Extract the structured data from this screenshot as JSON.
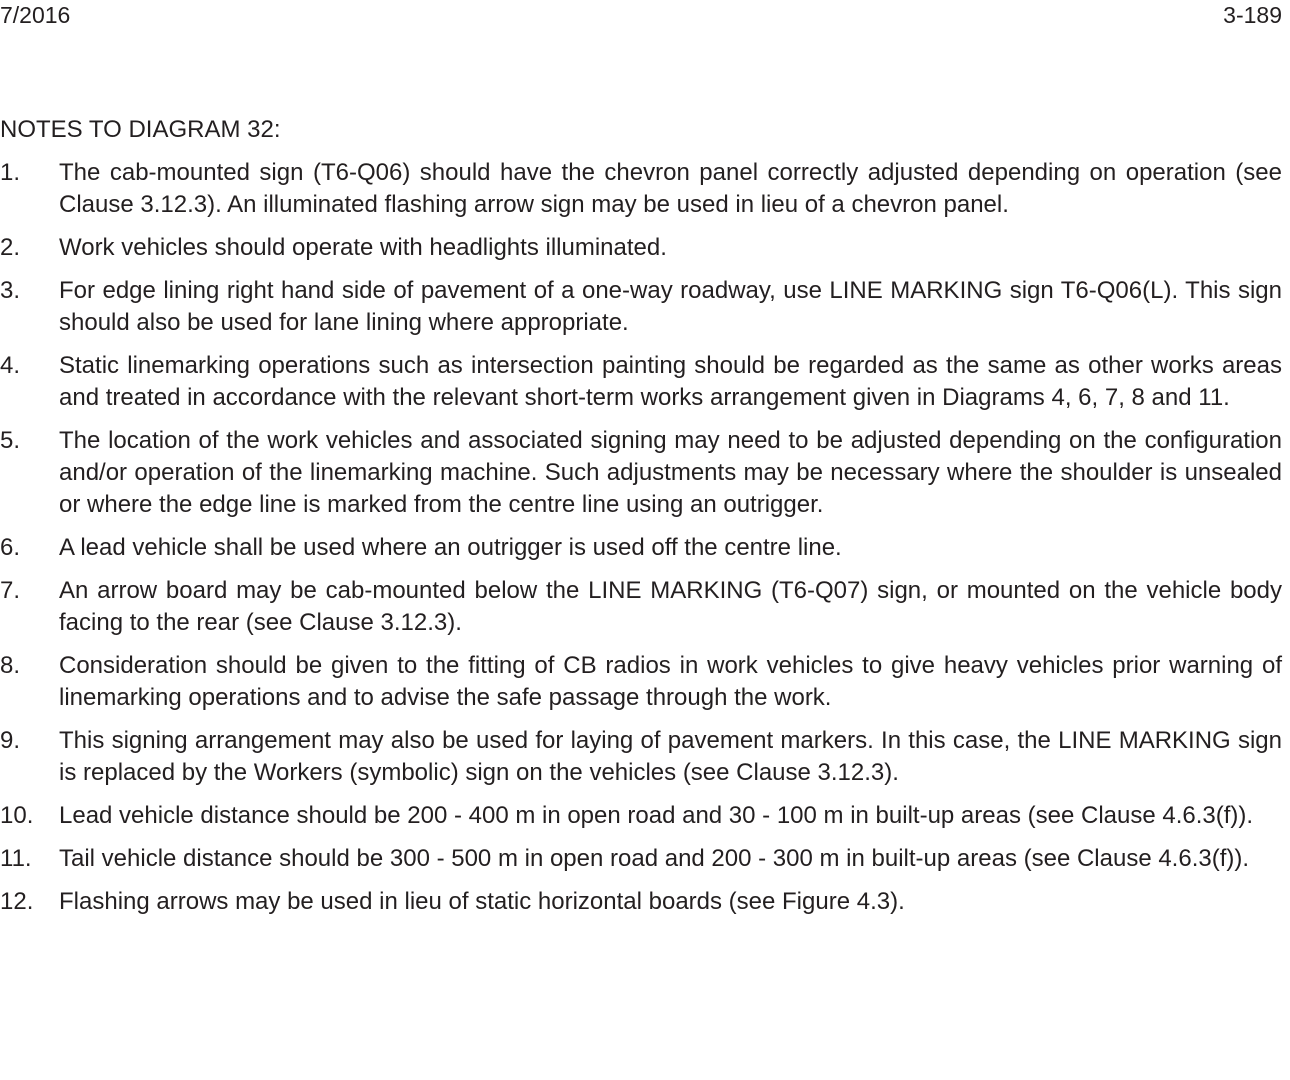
{
  "header": {
    "date": "7/2016",
    "page_number": "3-189"
  },
  "notes_heading": "NOTES TO DIAGRAM 32:",
  "notes": [
    {
      "num": "1.",
      "text": "The cab-mounted sign (T6-Q06) should have the chevron panel correctly adjusted depending on operation (see Clause 3.12.3). An illuminated flashing arrow sign may be used in lieu of a chevron panel."
    },
    {
      "num": "2.",
      "text": "Work vehicles should operate with headlights illuminated."
    },
    {
      "num": "3.",
      "text": "For edge lining right hand side of pavement of a one-way roadway, use LINE MARKING sign T6-Q06(L). This sign should also be used for lane lining where appropriate."
    },
    {
      "num": "4.",
      "text": "Static linemarking operations such as intersection painting should be regarded as the same as other works areas and treated in accordance with the relevant short-term works arrangement given in Diagrams 4, 6, 7, 8 and 11."
    },
    {
      "num": "5.",
      "text": "The location of the work vehicles and associated signing may need to be adjusted depending on the configuration and/or operation of the linemarking machine. Such adjustments may be necessary where the shoulder is unsealed or where the edge line is marked from the centre line using an outrigger."
    },
    {
      "num": "6.",
      "text": "A lead vehicle shall be used where an outrigger is used off the centre line."
    },
    {
      "num": "7.",
      "text": "An arrow board may be cab-mounted below the LINE MARKING (T6-Q07) sign, or mounted on the vehicle body facing to the rear (see Clause 3.12.3)."
    },
    {
      "num": "8.",
      "text": "Consideration should be given to the fitting of CB radios in work vehicles to give heavy vehicles prior warning of linemarking operations and to advise the safe passage through the work."
    },
    {
      "num": "9.",
      "text": "This signing arrangement may also be used for laying of pavement markers. In this case, the LINE MARKING sign is replaced by the Workers (symbolic) sign on the vehicles (see Clause 3.12.3)."
    },
    {
      "num": "10.",
      "text": "Lead vehicle distance should be 200 - 400 m in open road and 30 - 100 m in built-up areas (see Clause 4.6.3(f))."
    },
    {
      "num": "11.",
      "text": "Tail vehicle distance should be 300 - 500 m in open road and 200 - 300 m in built-up areas (see Clause 4.6.3(f))."
    },
    {
      "num": "12.",
      "text": "Flashing arrows may be used in lieu of static horizontal boards (see Figure 4.3)."
    }
  ]
}
